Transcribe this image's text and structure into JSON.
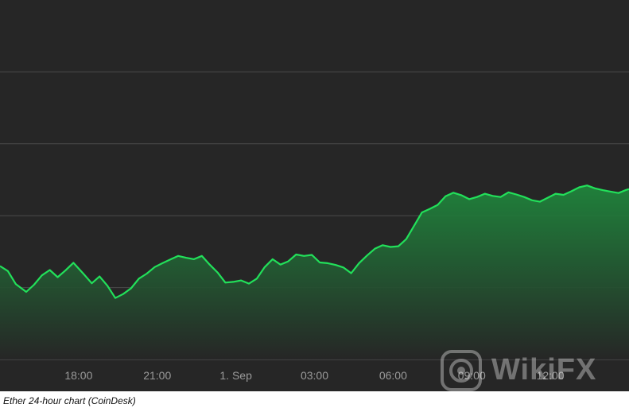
{
  "chart_data": {
    "type": "area",
    "title": "",
    "xlabel": "",
    "ylabel": "",
    "x_ticks": [
      "18:00",
      "21:00",
      "1. Sep",
      "03:00",
      "06:00",
      "09:00",
      "12:00"
    ],
    "x_tick_times": [
      3,
      6,
      9,
      12,
      15,
      18,
      21
    ],
    "xlim": [
      0,
      24
    ],
    "ylim": [
      0,
      100
    ],
    "y_gridlines": [
      20,
      40,
      60,
      80
    ],
    "y_tick_labels_visible": false,
    "grid": "horizontal",
    "series": [
      {
        "color": "#22e05a",
        "fill_top_color": "#1f8a3d",
        "fill_bottom_color": "#262626",
        "points": [
          [
            0.0,
            26.0
          ],
          [
            0.3,
            24.6
          ],
          [
            0.6,
            21.0
          ],
          [
            1.0,
            18.8
          ],
          [
            1.3,
            20.8
          ],
          [
            1.6,
            23.4
          ],
          [
            1.9,
            24.9
          ],
          [
            2.2,
            22.9
          ],
          [
            2.5,
            24.8
          ],
          [
            2.8,
            26.9
          ],
          [
            3.2,
            23.7
          ],
          [
            3.5,
            21.2
          ],
          [
            3.8,
            23.1
          ],
          [
            4.1,
            20.5
          ],
          [
            4.4,
            17.1
          ],
          [
            4.7,
            18.2
          ],
          [
            5.0,
            19.8
          ],
          [
            5.3,
            22.5
          ],
          [
            5.6,
            23.9
          ],
          [
            5.9,
            25.7
          ],
          [
            6.2,
            26.8
          ],
          [
            6.5,
            27.8
          ],
          [
            6.8,
            28.8
          ],
          [
            7.1,
            28.3
          ],
          [
            7.4,
            27.9
          ],
          [
            7.7,
            28.8
          ],
          [
            8.0,
            26.4
          ],
          [
            8.3,
            24.2
          ],
          [
            8.6,
            21.4
          ],
          [
            8.9,
            21.6
          ],
          [
            9.2,
            22.0
          ],
          [
            9.5,
            21.1
          ],
          [
            9.8,
            22.5
          ],
          [
            10.1,
            25.7
          ],
          [
            10.4,
            27.9
          ],
          [
            10.7,
            26.4
          ],
          [
            11.0,
            27.3
          ],
          [
            11.3,
            29.2
          ],
          [
            11.6,
            28.8
          ],
          [
            11.9,
            29.1
          ],
          [
            12.2,
            27.0
          ],
          [
            12.5,
            26.8
          ],
          [
            12.8,
            26.3
          ],
          [
            13.1,
            25.6
          ],
          [
            13.4,
            24.0
          ],
          [
            13.7,
            26.8
          ],
          [
            14.0,
            28.9
          ],
          [
            14.3,
            30.8
          ],
          [
            14.6,
            31.8
          ],
          [
            14.9,
            31.3
          ],
          [
            15.2,
            31.5
          ],
          [
            15.5,
            33.5
          ],
          [
            15.8,
            37.2
          ],
          [
            16.1,
            40.9
          ],
          [
            16.4,
            41.9
          ],
          [
            16.7,
            43.0
          ],
          [
            17.0,
            45.4
          ],
          [
            17.3,
            46.4
          ],
          [
            17.6,
            45.7
          ],
          [
            17.9,
            44.6
          ],
          [
            18.2,
            45.2
          ],
          [
            18.5,
            46.1
          ],
          [
            18.8,
            45.5
          ],
          [
            19.1,
            45.2
          ],
          [
            19.4,
            46.5
          ],
          [
            19.7,
            45.9
          ],
          [
            20.0,
            45.2
          ],
          [
            20.3,
            44.3
          ],
          [
            20.6,
            43.9
          ],
          [
            20.9,
            45.0
          ],
          [
            21.2,
            46.1
          ],
          [
            21.5,
            45.8
          ],
          [
            21.8,
            46.8
          ],
          [
            22.1,
            47.9
          ],
          [
            22.4,
            48.4
          ],
          [
            22.7,
            47.6
          ],
          [
            23.0,
            47.1
          ],
          [
            23.3,
            46.7
          ],
          [
            23.6,
            46.3
          ],
          [
            23.9,
            47.2
          ],
          [
            24.0,
            47.4
          ]
        ]
      }
    ],
    "caption": "Ether 24-hour chart (CoinDesk)"
  },
  "watermark": {
    "text": "WikiFX",
    "logo_icon": "wikifx-logo-icon",
    "color": "#ffffff"
  },
  "colors": {
    "background": "#262626",
    "grid": "#4a4a4a",
    "axis_text": "#9a9a9a"
  }
}
